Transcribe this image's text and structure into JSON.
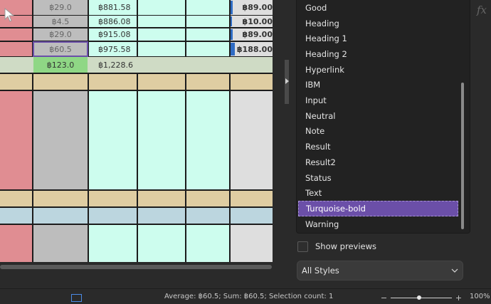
{
  "sheet": {
    "rows": [
      {
        "c1": "฿29.0",
        "c2": "฿881.58",
        "c5": "฿89.00",
        "bar": 0.45
      },
      {
        "c1": "฿4.5",
        "c2": "฿886.08",
        "c5": "฿10.00",
        "bar": 0.05
      },
      {
        "c1": "฿29.0",
        "c2": "฿915.08",
        "c5": "฿89.00",
        "bar": 0.45
      },
      {
        "c1": "฿60.5",
        "c2": "฿975.58",
        "c5": "฿188.00",
        "bar": 1.0
      }
    ],
    "total_row": {
      "c1": "฿123.0",
      "c2": "฿1,228.6"
    },
    "colors": {
      "pink": "#e08d92",
      "gray": "#bdbdbd",
      "cyan": "#cdfdee",
      "light": "#dedede",
      "tan": "#dfcda2",
      "blue": "#bcd6df",
      "sage": "#cfdbc5",
      "green": "#8fd785",
      "selection": "#6b4fa8"
    }
  },
  "styles_panel": {
    "items": [
      {
        "label": "Good"
      },
      {
        "label": "Heading"
      },
      {
        "label": "Heading 1"
      },
      {
        "label": "Heading 2"
      },
      {
        "label": "Hyperlink"
      },
      {
        "label": "IBM"
      },
      {
        "label": "Input"
      },
      {
        "label": "Neutral"
      },
      {
        "label": "Note"
      },
      {
        "label": "Result"
      },
      {
        "label": "Result2"
      },
      {
        "label": "Status"
      },
      {
        "label": "Text"
      },
      {
        "label": "Turquoise-bold",
        "selected": true
      },
      {
        "label": "Warning"
      }
    ],
    "fx_icon": "function-icon",
    "show_previews_label": "Show previews",
    "show_previews_checked": false,
    "category": "All Styles"
  },
  "status_bar": {
    "summary": "Average: ฿60.5; Sum: ฿60.5; Selection count: 1",
    "zoom": "100%",
    "zoom_fraction": 0.46
  }
}
